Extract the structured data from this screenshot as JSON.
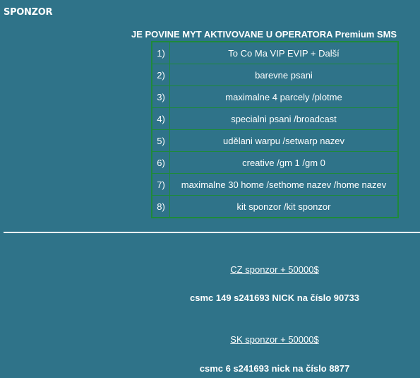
{
  "page": {
    "heading": "SPONZOR",
    "notice": "JE POVINE MYT AKTIVOVANE U OPERATORA Premium SMS"
  },
  "perks": [
    {
      "num": "1)",
      "text": "To Co Ma VIP EVIP + Další"
    },
    {
      "num": "2)",
      "text": "barevne psani"
    },
    {
      "num": "3)",
      "text": "maximalne 4 parcely /plotme"
    },
    {
      "num": "4)",
      "text": "specialni psani /broadcast"
    },
    {
      "num": "5)",
      "text": "udělani warpu /setwarp nazev"
    },
    {
      "num": "6)",
      "text": "creative /gm 1 /gm 0"
    },
    {
      "num": "7)",
      "text": "maximalne 30 home /sethome nazev /home nazev"
    },
    {
      "num": "8)",
      "text": "kit sponzor /kit sponzor"
    }
  ],
  "offers": {
    "cz": {
      "link": "CZ sponzor + 50000$",
      "sms": "csmc 149 s241693 NICK na číslo 90733"
    },
    "sk": {
      "link": "SK sponzor + 50000$",
      "sms": "csmc 6 s241693 nick na číslo 8877"
    }
  }
}
